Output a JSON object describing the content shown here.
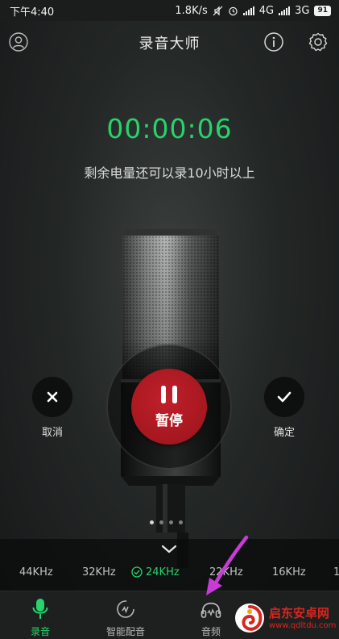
{
  "status_bar": {
    "time": "下午4:40",
    "net_speed": "1.8K/s",
    "network1": "4G",
    "network2": "3G",
    "battery": "91"
  },
  "header": {
    "title": "录音大师",
    "left_icon": "user-icon",
    "right_icons": [
      "info-icon",
      "gear-icon"
    ]
  },
  "recorder": {
    "timer": "00:00:06",
    "remaining_text": "剩余电量还可以录10小时以上",
    "cancel_label": "取消",
    "pause_label": "暂停",
    "confirm_label": "确定",
    "page_dots": 4,
    "active_dot": 0
  },
  "frequencies": {
    "options": [
      "44KHz",
      "32KHz",
      "24KHz",
      "22KHz",
      "16KHz",
      "1"
    ],
    "selected": "24KHz"
  },
  "bottom_nav": {
    "items": [
      {
        "label": "录音",
        "icon": "mic-icon",
        "active": true
      },
      {
        "label": "智能配音",
        "icon": "dubbing-icon",
        "active": false
      },
      {
        "label": "音频",
        "icon": "headphones-icon",
        "active": false
      }
    ]
  },
  "watermark": {
    "name": "启东安卓网",
    "url": "www.qdltdu.com"
  },
  "colors": {
    "accent_green": "#27d36b",
    "pause_red": "#a5171f",
    "background": "#1e2221",
    "arrow_purple": "#c93bd9"
  }
}
